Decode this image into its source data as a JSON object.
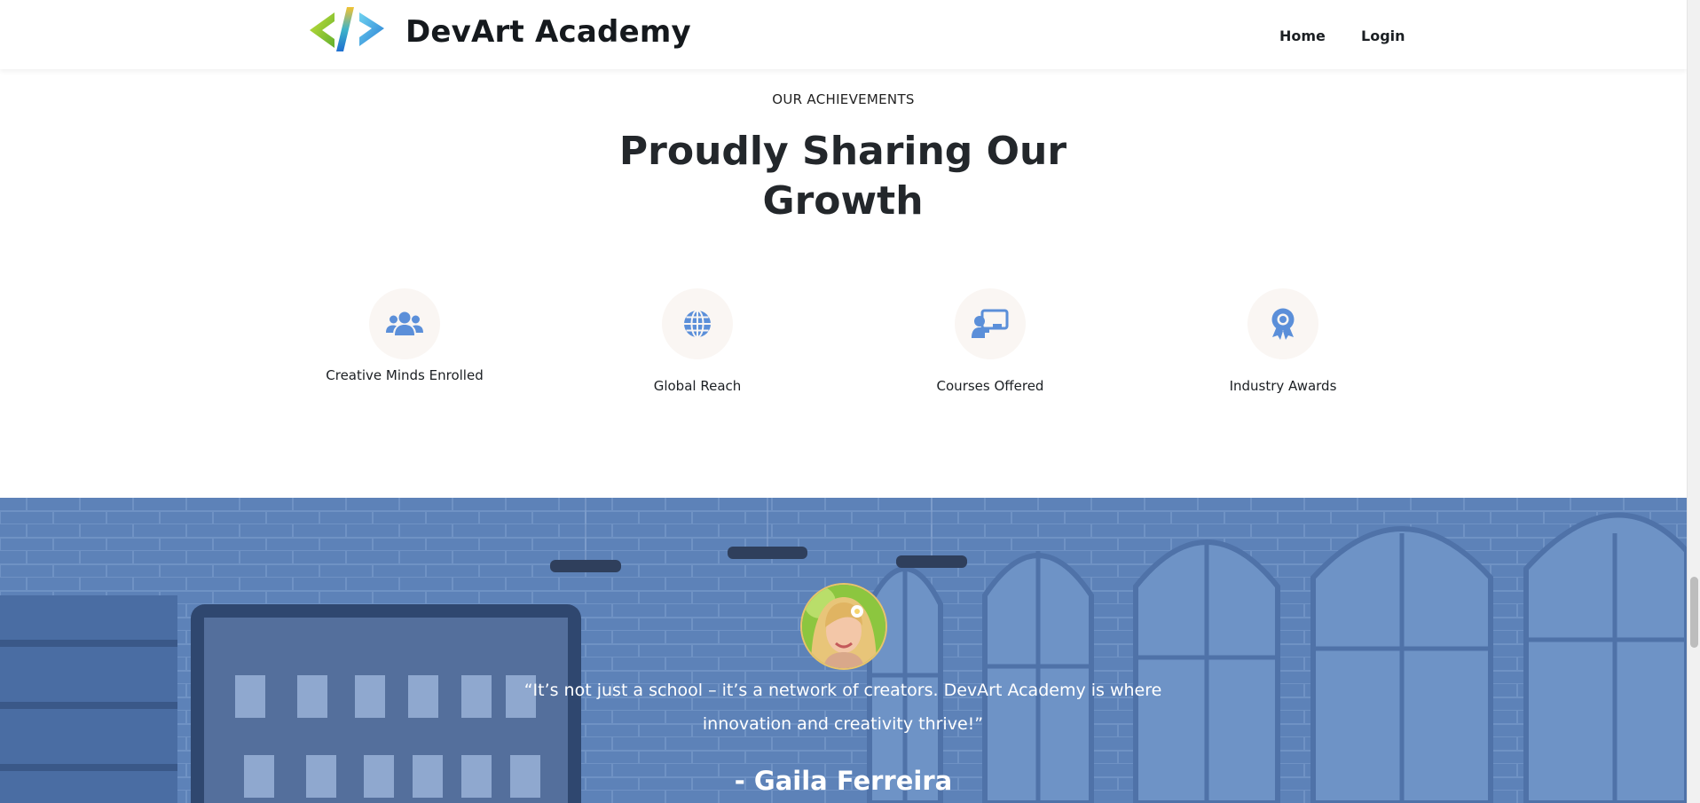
{
  "header": {
    "brand": "DevArt Academy",
    "logo_icon": "code-brackets-logo",
    "nav": [
      {
        "label": "Home"
      },
      {
        "label": "Login"
      }
    ]
  },
  "achievements": {
    "eyebrow": "OUR ACHIEVEMENTS",
    "title": "Proudly Sharing Our Growth",
    "stats": [
      {
        "label": "Creative Minds Enrolled",
        "icon": "users-icon"
      },
      {
        "label": "Global Reach",
        "icon": "globe-icon"
      },
      {
        "label": "Courses Offered",
        "icon": "chalkboard-teacher-icon"
      },
      {
        "label": "Industry Awards",
        "icon": "award-icon"
      }
    ],
    "icon_color": "#5b8fd9",
    "circle_color": "#faf6f3"
  },
  "testimonial": {
    "quote": "“It’s not just a school – it’s a network of creators. DevArt Academy is where innovation and creativity thrive!”",
    "author": "- Gaila Ferreira",
    "overlay_color": "#5b7fb6"
  }
}
